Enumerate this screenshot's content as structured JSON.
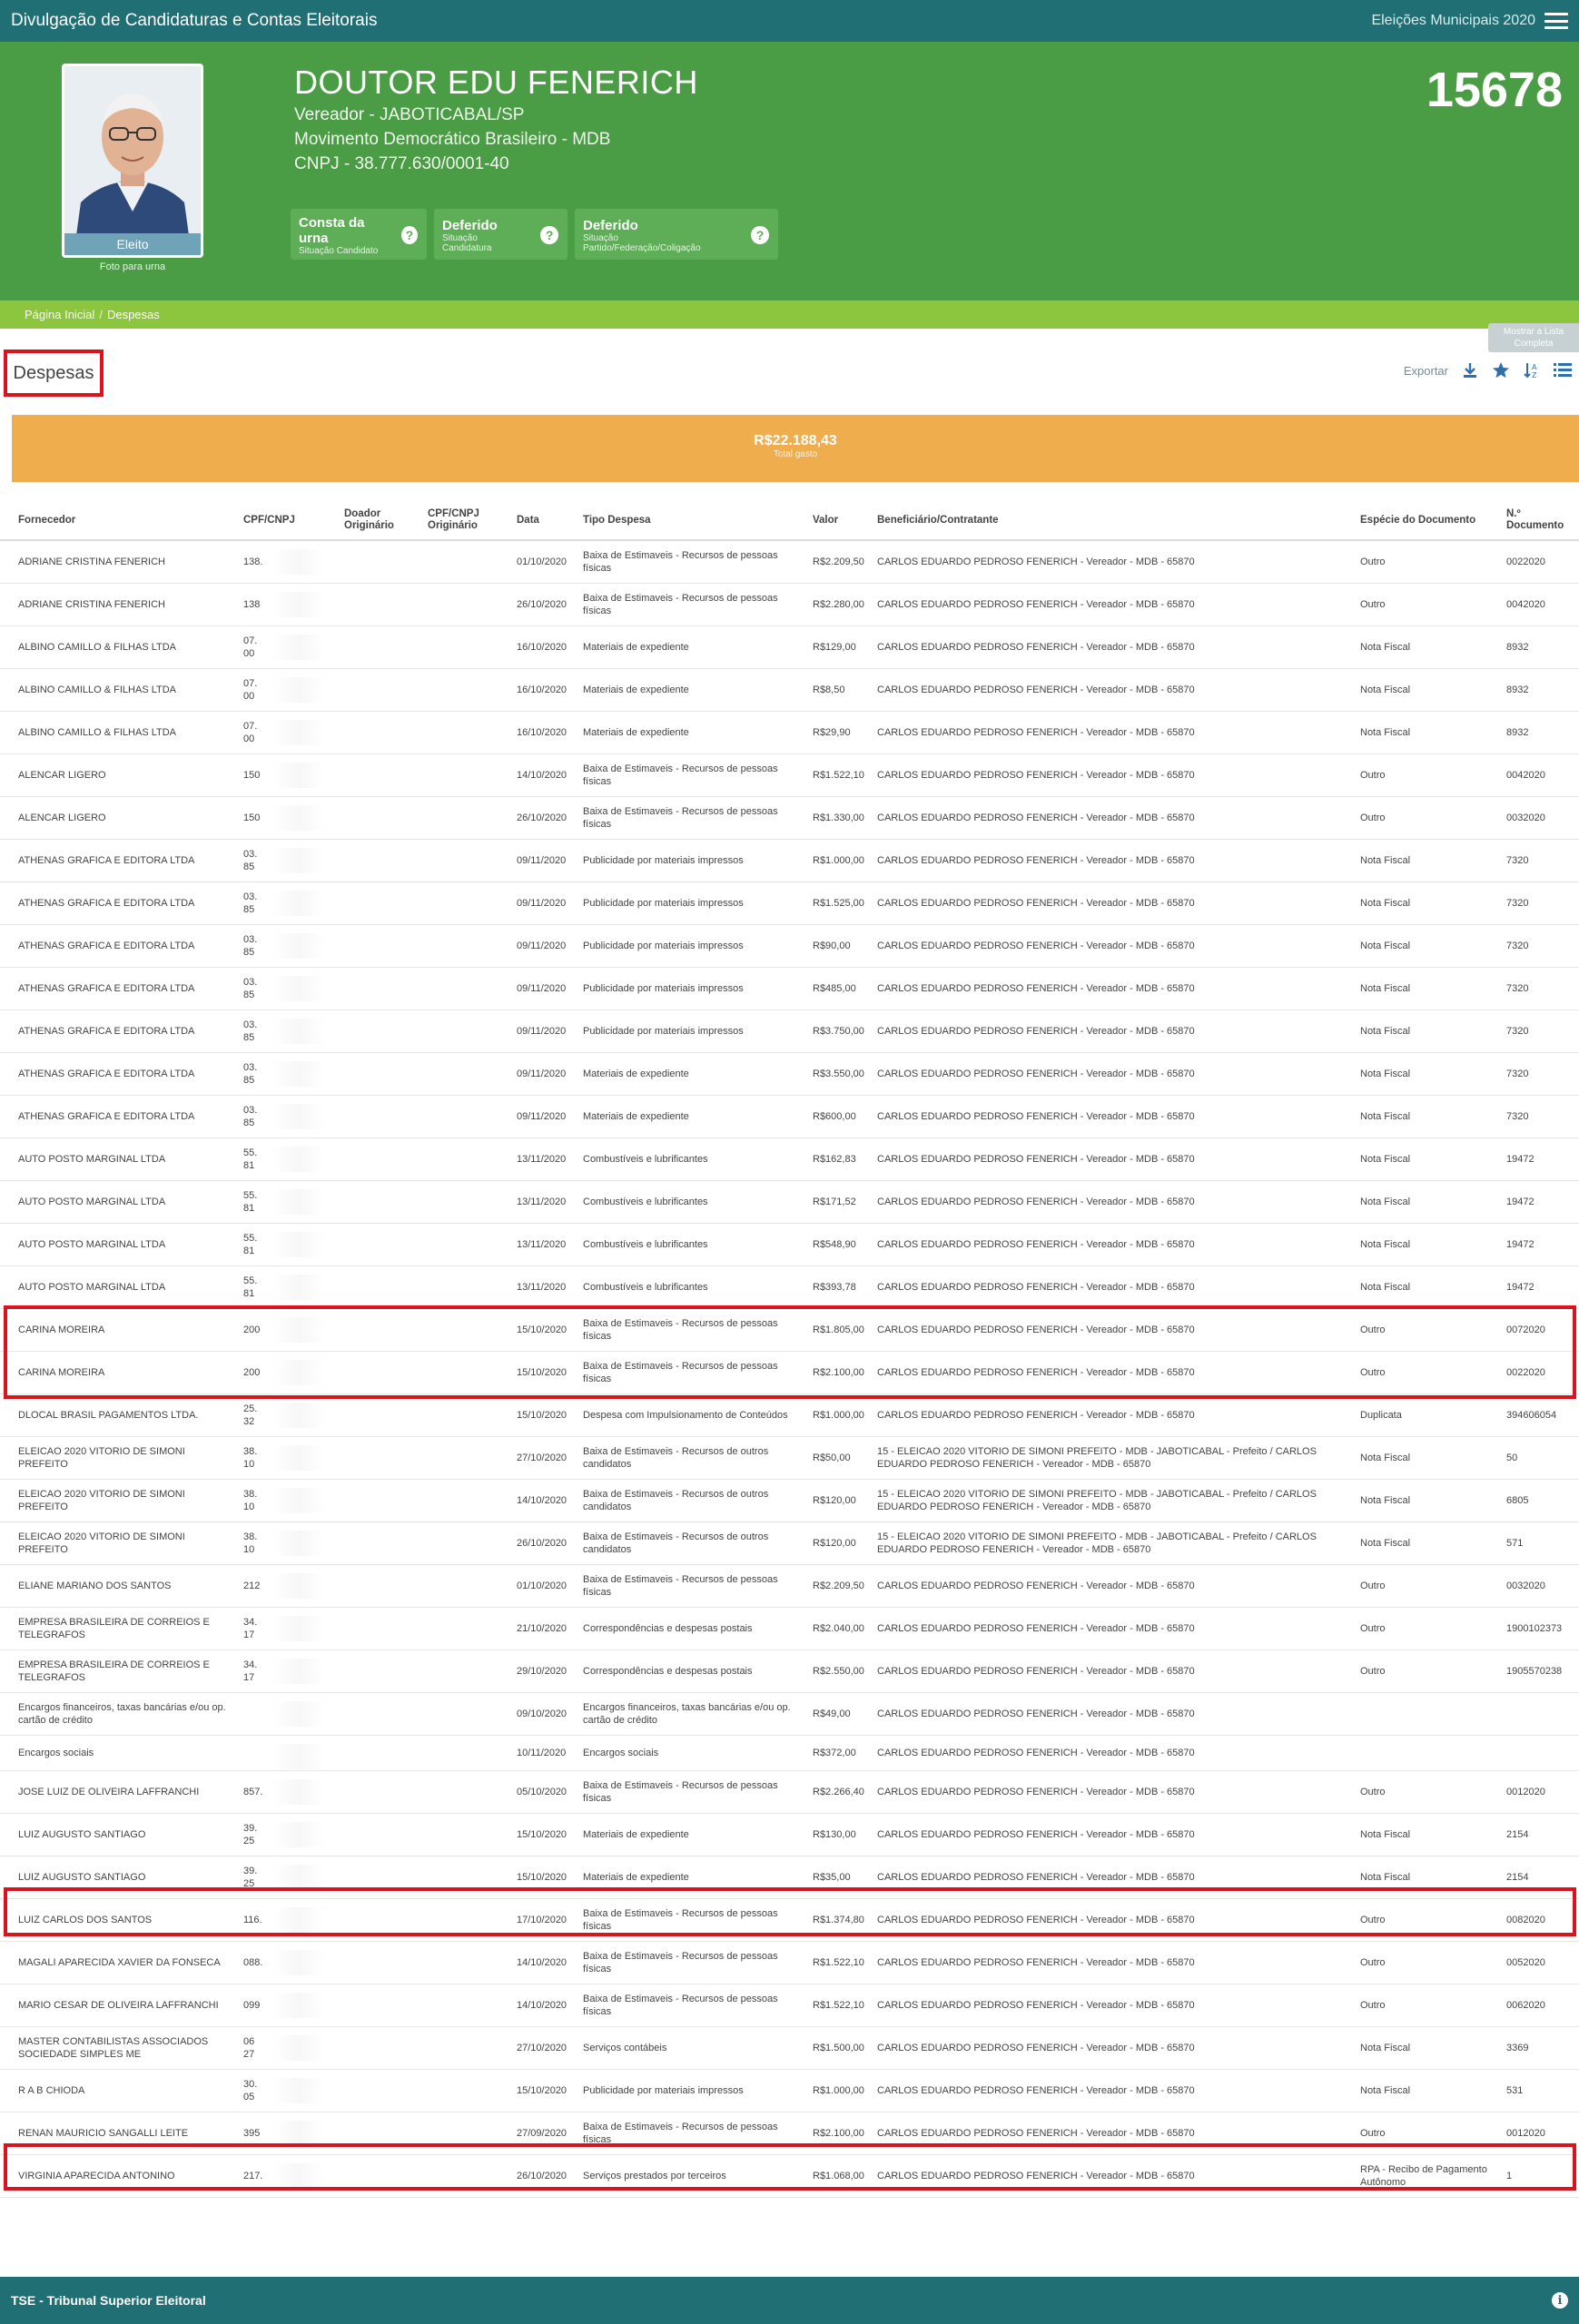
{
  "topbar": {
    "title": "Divulgação de Candidaturas e Contas Eleitorais",
    "election": "Eleições Municipais 2020"
  },
  "candidate": {
    "name": "DOUTOR EDU FENERICH",
    "office": "Vereador - JABOTICABAL/SP",
    "party": "Movimento Democrático Brasileiro - MDB",
    "cnpj": "CNPJ - 38.777.630/0001-40",
    "number": "15678",
    "photo_status": "Eleito",
    "photo_caption": "Foto para urna",
    "badges": [
      {
        "main": "Consta da urna",
        "sub": "Situação Candidato"
      },
      {
        "main": "Deferido",
        "sub": "Situação Candidatura"
      },
      {
        "main": "Deferido",
        "sub": "Situação Partido/Federação/Coligação"
      }
    ]
  },
  "breadcrumb": {
    "home": "Página Inicial",
    "sep": "/",
    "current": "Despesas"
  },
  "floating_button": "Mostrar a Lista Completa",
  "section": {
    "title": "Despesas"
  },
  "toolbar": {
    "export_label": "Exportar"
  },
  "total": {
    "amount": "R$22.188,43",
    "label": "Total gasto"
  },
  "table": {
    "headers": {
      "fornecedor": "Fornecedor",
      "cpf": "CPF/CNPJ",
      "doador": "Doador Originário",
      "cpf_orig": "CPF/CNPJ Originário",
      "data": "Data",
      "tipo": "Tipo Despesa",
      "valor": "Valor",
      "benef": "Beneficiário/Contratante",
      "especie": "Espécie do Documento",
      "numdoc": "N.º Documento"
    },
    "rows": [
      {
        "fornecedor": "ADRIANE CRISTINA FENERICH",
        "cpf": "138.           19",
        "data": "01/10/2020",
        "tipo": "Baixa de Estimaveis - Recursos de pessoas físicas",
        "valor": "R$2.209,50",
        "benef": "CARLOS EDUARDO PEDROSO FENERICH - Vereador - MDB - 65870",
        "especie": "Outro",
        "numdoc": "0022020"
      },
      {
        "fornecedor": "ADRIANE CRISTINA FENERICH",
        "cpf": "138            -19",
        "data": "26/10/2020",
        "tipo": "Baixa de Estimaveis - Recursos de pessoas físicas",
        "valor": "R$2.280,00",
        "benef": "CARLOS EDUARDO PEDROSO FENERICH - Vereador - MDB - 65870",
        "especie": "Outro",
        "numdoc": "0042020"
      },
      {
        "fornecedor": "ALBINO CAMILLO & FILHAS LTDA",
        "cpf": "07.\n00",
        "data": "16/10/2020",
        "tipo": "Materiais de expediente",
        "valor": "R$129,00",
        "benef": "CARLOS EDUARDO PEDROSO FENERICH - Vereador - MDB - 65870",
        "especie": "Nota Fiscal",
        "numdoc": "8932"
      },
      {
        "fornecedor": "ALBINO CAMILLO & FILHAS LTDA",
        "cpf": "07.\n00",
        "data": "16/10/2020",
        "tipo": "Materiais de expediente",
        "valor": "R$8,50",
        "benef": "CARLOS EDUARDO PEDROSO FENERICH - Vereador - MDB - 65870",
        "especie": "Nota Fiscal",
        "numdoc": "8932"
      },
      {
        "fornecedor": "ALBINO CAMILLO & FILHAS LTDA",
        "cpf": "07.\n00",
        "data": "16/10/2020",
        "tipo": "Materiais de expediente",
        "valor": "R$29,90",
        "benef": "CARLOS EDUARDO PEDROSO FENERICH - Vereador - MDB - 65870",
        "especie": "Nota Fiscal",
        "numdoc": "8932"
      },
      {
        "fornecedor": "ALENCAR LIGERO",
        "cpf": "150            13",
        "data": "14/10/2020",
        "tipo": "Baixa de Estimaveis - Recursos de pessoas físicas",
        "valor": "R$1.522,10",
        "benef": "CARLOS EDUARDO PEDROSO FENERICH - Vereador - MDB - 65870",
        "especie": "Outro",
        "numdoc": "0042020"
      },
      {
        "fornecedor": "ALENCAR LIGERO",
        "cpf": "150            13",
        "data": "26/10/2020",
        "tipo": "Baixa de Estimaveis - Recursos de pessoas físicas",
        "valor": "R$1.330,00",
        "benef": "CARLOS EDUARDO PEDROSO FENERICH - Vereador - MDB - 65870",
        "especie": "Outro",
        "numdoc": "0032020"
      },
      {
        "fornecedor": "ATHENAS GRAFICA E EDITORA LTDA",
        "cpf": "03.\n85",
        "data": "09/11/2020",
        "tipo": "Publicidade por materiais impressos",
        "valor": "R$1.000,00",
        "benef": "CARLOS EDUARDO PEDROSO FENERICH - Vereador - MDB - 65870",
        "especie": "Nota Fiscal",
        "numdoc": "7320"
      },
      {
        "fornecedor": "ATHENAS GRAFICA E EDITORA LTDA",
        "cpf": "03.\n85",
        "data": "09/11/2020",
        "tipo": "Publicidade por materiais impressos",
        "valor": "R$1.525,00",
        "benef": "CARLOS EDUARDO PEDROSO FENERICH - Vereador - MDB - 65870",
        "especie": "Nota Fiscal",
        "numdoc": "7320"
      },
      {
        "fornecedor": "ATHENAS GRAFICA E EDITORA LTDA",
        "cpf": "03.\n85",
        "data": "09/11/2020",
        "tipo": "Publicidade por materiais impressos",
        "valor": "R$90,00",
        "benef": "CARLOS EDUARDO PEDROSO FENERICH - Vereador - MDB - 65870",
        "especie": "Nota Fiscal",
        "numdoc": "7320"
      },
      {
        "fornecedor": "ATHENAS GRAFICA E EDITORA LTDA",
        "cpf": "03.\n85",
        "data": "09/11/2020",
        "tipo": "Publicidade por materiais impressos",
        "valor": "R$485,00",
        "benef": "CARLOS EDUARDO PEDROSO FENERICH - Vereador - MDB - 65870",
        "especie": "Nota Fiscal",
        "numdoc": "7320"
      },
      {
        "fornecedor": "ATHENAS GRAFICA E EDITORA LTDA",
        "cpf": "03.\n85",
        "data": "09/11/2020",
        "tipo": "Publicidade por materiais impressos",
        "valor": "R$3.750,00",
        "benef": "CARLOS EDUARDO PEDROSO FENERICH - Vereador - MDB - 65870",
        "especie": "Nota Fiscal",
        "numdoc": "7320"
      },
      {
        "fornecedor": "ATHENAS GRAFICA E EDITORA LTDA",
        "cpf": "03.\n85",
        "data": "09/11/2020",
        "tipo": "Materiais de expediente",
        "valor": "R$3.550,00",
        "benef": "CARLOS EDUARDO PEDROSO FENERICH - Vereador - MDB - 65870",
        "especie": "Nota Fiscal",
        "numdoc": "7320"
      },
      {
        "fornecedor": "ATHENAS GRAFICA E EDITORA LTDA",
        "cpf": "03.\n85",
        "data": "09/11/2020",
        "tipo": "Materiais de expediente",
        "valor": "R$600,00",
        "benef": "CARLOS EDUARDO PEDROSO FENERICH - Vereador - MDB - 65870",
        "especie": "Nota Fiscal",
        "numdoc": "7320"
      },
      {
        "fornecedor": "AUTO POSTO MARGINAL LTDA",
        "cpf": "55.\n81",
        "data": "13/11/2020",
        "tipo": "Combustíveis e lubrificantes",
        "valor": "R$162,83",
        "benef": "CARLOS EDUARDO PEDROSO FENERICH - Vereador - MDB - 65870",
        "especie": "Nota Fiscal",
        "numdoc": "19472"
      },
      {
        "fornecedor": "AUTO POSTO MARGINAL LTDA",
        "cpf": "55.\n81",
        "data": "13/11/2020",
        "tipo": "Combustíveis e lubrificantes",
        "valor": "R$171,52",
        "benef": "CARLOS EDUARDO PEDROSO FENERICH - Vereador - MDB - 65870",
        "especie": "Nota Fiscal",
        "numdoc": "19472"
      },
      {
        "fornecedor": "AUTO POSTO MARGINAL LTDA",
        "cpf": "55.\n81",
        "data": "13/11/2020",
        "tipo": "Combustíveis e lubrificantes",
        "valor": "R$548,90",
        "benef": "CARLOS EDUARDO PEDROSO FENERICH - Vereador - MDB - 65870",
        "especie": "Nota Fiscal",
        "numdoc": "19472"
      },
      {
        "fornecedor": "AUTO POSTO MARGINAL LTDA",
        "cpf": "55.\n81",
        "data": "13/11/2020",
        "tipo": "Combustíveis e lubrificantes",
        "valor": "R$393,78",
        "benef": "CARLOS EDUARDO PEDROSO FENERICH - Vereador - MDB - 65870",
        "especie": "Nota Fiscal",
        "numdoc": "19472"
      },
      {
        "fornecedor": "CARINA MOREIRA",
        "cpf": "200            -88",
        "data": "15/10/2020",
        "tipo": "Baixa de Estimaveis - Recursos de pessoas físicas",
        "valor": "R$1.805,00",
        "benef": "CARLOS EDUARDO PEDROSO FENERICH - Vereador - MDB - 65870",
        "especie": "Outro",
        "numdoc": "0072020"
      },
      {
        "fornecedor": "CARINA MOREIRA",
        "cpf": "200            -88",
        "data": "15/10/2020",
        "tipo": "Baixa de Estimaveis - Recursos de pessoas físicas",
        "valor": "R$2.100,00",
        "benef": "CARLOS EDUARDO PEDROSO FENERICH - Vereador - MDB - 65870",
        "especie": "Outro",
        "numdoc": "0022020"
      },
      {
        "fornecedor": "DLOCAL BRASIL PAGAMENTOS LTDA.",
        "cpf": "25.\n32",
        "data": "15/10/2020",
        "tipo": "Despesa com Impulsionamento de Conteúdos",
        "valor": "R$1.000,00",
        "benef": "CARLOS EDUARDO PEDROSO FENERICH - Vereador - MDB - 65870",
        "especie": "Duplicata",
        "numdoc": "394606054"
      },
      {
        "fornecedor": "ELEICAO 2020 VITORIO DE SIMONI PREFEITO",
        "cpf": "38.\n10",
        "data": "27/10/2020",
        "tipo": "Baixa de Estimaveis - Recursos de outros candidatos",
        "valor": "R$50,00",
        "benef": "15 - ELEICAO 2020 VITORIO DE SIMONI PREFEITO - MDB - JABOTICABAL - Prefeito / CARLOS EDUARDO PEDROSO FENERICH - Vereador - MDB - 65870",
        "especie": "Nota Fiscal",
        "numdoc": "50"
      },
      {
        "fornecedor": "ELEICAO 2020 VITORIO DE SIMONI PREFEITO",
        "cpf": "38.\n10",
        "data": "14/10/2020",
        "tipo": "Baixa de Estimaveis - Recursos de outros candidatos",
        "valor": "R$120,00",
        "benef": "15 - ELEICAO 2020 VITORIO DE SIMONI PREFEITO - MDB - JABOTICABAL - Prefeito / CARLOS EDUARDO PEDROSO FENERICH - Vereador - MDB - 65870",
        "especie": "Nota Fiscal",
        "numdoc": "6805"
      },
      {
        "fornecedor": "ELEICAO 2020 VITORIO DE SIMONI PREFEITO",
        "cpf": "38.\n10",
        "data": "26/10/2020",
        "tipo": "Baixa de Estimaveis - Recursos de outros candidatos",
        "valor": "R$120,00",
        "benef": "15 - ELEICAO 2020 VITORIO DE SIMONI PREFEITO - MDB - JABOTICABAL - Prefeito / CARLOS EDUARDO PEDROSO FENERICH - Vereador - MDB - 65870",
        "especie": "Nota Fiscal",
        "numdoc": "571"
      },
      {
        "fornecedor": "ELIANE MARIANO DOS SANTOS",
        "cpf": "212            50",
        "data": "01/10/2020",
        "tipo": "Baixa de Estimaveis - Recursos de pessoas físicas",
        "valor": "R$2.209,50",
        "benef": "CARLOS EDUARDO PEDROSO FENERICH - Vereador - MDB - 65870",
        "especie": "Outro",
        "numdoc": "0032020"
      },
      {
        "fornecedor": "EMPRESA BRASILEIRA DE CORREIOS E TELEGRAFOS",
        "cpf": "34.\n17",
        "data": "21/10/2020",
        "tipo": "Correspondências e despesas postais",
        "valor": "R$2.040,00",
        "benef": "CARLOS EDUARDO PEDROSO FENERICH - Vereador - MDB - 65870",
        "especie": "Outro",
        "numdoc": "1900102373"
      },
      {
        "fornecedor": "EMPRESA BRASILEIRA DE CORREIOS E TELEGRAFOS",
        "cpf": "34.\n17",
        "data": "29/10/2020",
        "tipo": "Correspondências e despesas postais",
        "valor": "R$2.550,00",
        "benef": "CARLOS EDUARDO PEDROSO FENERICH - Vereador - MDB - 65870",
        "especie": "Outro",
        "numdoc": "1905570238"
      },
      {
        "fornecedor": "Encargos financeiros, taxas bancárias e/ou op. cartão de crédito",
        "cpf": "",
        "data": "09/10/2020",
        "tipo": "Encargos financeiros, taxas bancárias e/ou op. cartão de crédito",
        "valor": "R$49,00",
        "benef": "CARLOS EDUARDO PEDROSO FENERICH - Vereador - MDB - 65870",
        "especie": "",
        "numdoc": ""
      },
      {
        "fornecedor": "Encargos sociais",
        "cpf": "",
        "data": "10/11/2020",
        "tipo": "Encargos sociais",
        "valor": "R$372,00",
        "benef": "CARLOS EDUARDO PEDROSO FENERICH - Vereador - MDB - 65870",
        "especie": "",
        "numdoc": ""
      },
      {
        "fornecedor": "JOSE LUIZ DE OLIVEIRA LAFFRANCHI",
        "cpf": "857.           53",
        "data": "05/10/2020",
        "tipo": "Baixa de Estimaveis - Recursos de pessoas físicas",
        "valor": "R$2.266,40",
        "benef": "CARLOS EDUARDO PEDROSO FENERICH - Vereador - MDB - 65870",
        "especie": "Outro",
        "numdoc": "0012020"
      },
      {
        "fornecedor": "LUIZ AUGUSTO SANTIAGO",
        "cpf": "39.\n25",
        "data": "15/10/2020",
        "tipo": "Materiais de expediente",
        "valor": "R$130,00",
        "benef": "CARLOS EDUARDO PEDROSO FENERICH - Vereador - MDB - 65870",
        "especie": "Nota Fiscal",
        "numdoc": "2154"
      },
      {
        "fornecedor": "LUIZ AUGUSTO SANTIAGO",
        "cpf": "39.\n25",
        "data": "15/10/2020",
        "tipo": "Materiais de expediente",
        "valor": "R$35,00",
        "benef": "CARLOS EDUARDO PEDROSO FENERICH - Vereador - MDB - 65870",
        "especie": "Nota Fiscal",
        "numdoc": "2154"
      },
      {
        "fornecedor": "LUIZ CARLOS DOS SANTOS",
        "cpf": "116.           -50",
        "data": "17/10/2020",
        "tipo": "Baixa de Estimaveis - Recursos de pessoas físicas",
        "valor": "R$1.374,80",
        "benef": "CARLOS EDUARDO PEDROSO FENERICH - Vereador - MDB - 65870",
        "especie": "Outro",
        "numdoc": "0082020"
      },
      {
        "fornecedor": "MAGALI APARECIDA XAVIER DA FONSECA",
        "cpf": "088.           -76",
        "data": "14/10/2020",
        "tipo": "Baixa de Estimaveis - Recursos de pessoas físicas",
        "valor": "R$1.522,10",
        "benef": "CARLOS EDUARDO PEDROSO FENERICH - Vereador - MDB - 65870",
        "especie": "Outro",
        "numdoc": "0052020"
      },
      {
        "fornecedor": "MARIO CESAR DE OLIVEIRA LAFFRANCHI",
        "cpf": "099            -51",
        "data": "14/10/2020",
        "tipo": "Baixa de Estimaveis - Recursos de pessoas físicas",
        "valor": "R$1.522,10",
        "benef": "CARLOS EDUARDO PEDROSO FENERICH - Vereador - MDB - 65870",
        "especie": "Outro",
        "numdoc": "0062020"
      },
      {
        "fornecedor": "MASTER CONTABILISTAS ASSOCIADOS SOCIEDADE SIMPLES ME",
        "cpf": "06\n27",
        "data": "27/10/2020",
        "tipo": "Serviços contábeis",
        "valor": "R$1.500,00",
        "benef": "CARLOS EDUARDO PEDROSO FENERICH - Vereador - MDB - 65870",
        "especie": "Nota Fiscal",
        "numdoc": "3369"
      },
      {
        "fornecedor": "R A B CHIODA",
        "cpf": "30.\n05",
        "data": "15/10/2020",
        "tipo": "Publicidade por materiais impressos",
        "valor": "R$1.000,00",
        "benef": "CARLOS EDUARDO PEDROSO FENERICH - Vereador - MDB - 65870",
        "especie": "Nota Fiscal",
        "numdoc": "531"
      },
      {
        "fornecedor": "RENAN MAURICIO SANGALLI LEITE",
        "cpf": "395            -74",
        "data": "27/09/2020",
        "tipo": "Baixa de Estimaveis - Recursos de pessoas físicas",
        "valor": "R$2.100,00",
        "benef": "CARLOS EDUARDO PEDROSO FENERICH - Vereador - MDB - 65870",
        "especie": "Outro",
        "numdoc": "0012020"
      },
      {
        "fornecedor": "VIRGINIA APARECIDA ANTONINO",
        "cpf": "217.           -64",
        "data": "26/10/2020",
        "tipo": "Serviços prestados por terceiros",
        "valor": "R$1.068,00",
        "benef": "CARLOS EDUARDO PEDROSO FENERICH - Vereador - MDB - 65870",
        "especie": "RPA - Recibo de Pagamento Autônomo",
        "numdoc": "1"
      }
    ]
  },
  "footer": {
    "text": "TSE - Tribunal Superior Eleitoral"
  },
  "colors": {
    "topbar": "#1f6f75",
    "header": "#4a9c45",
    "breadcrumb": "#8cc63f",
    "total": "#f0ad4e",
    "highlight": "#d9141f"
  },
  "icons": [
    "hamburger-icon",
    "help-icon",
    "download-icon",
    "star-icon",
    "sort-icon",
    "list-icon",
    "info-icon"
  ]
}
